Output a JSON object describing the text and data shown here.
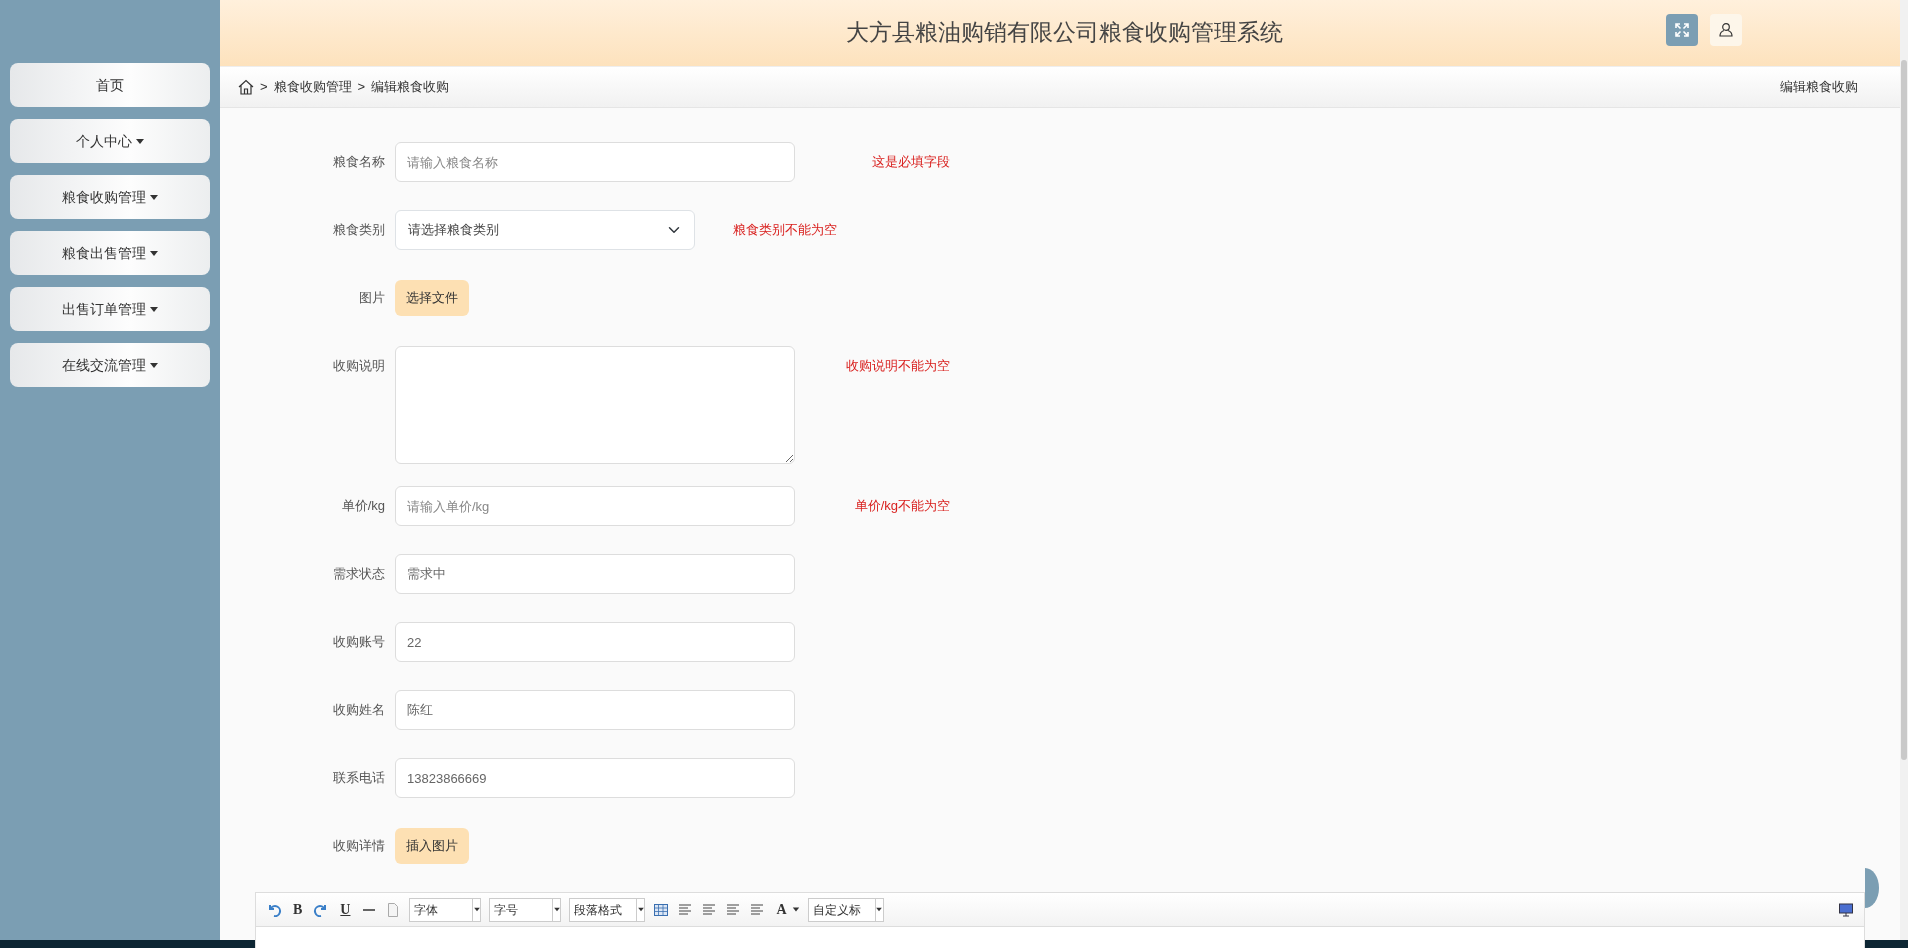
{
  "header": {
    "title": "大方县粮油购销有限公司粮食收购管理系统"
  },
  "sidebar": {
    "items": [
      {
        "label": "首页",
        "dropdown": false
      },
      {
        "label": "个人中心",
        "dropdown": true
      },
      {
        "label": "粮食收购管理",
        "dropdown": true
      },
      {
        "label": "粮食出售管理",
        "dropdown": true
      },
      {
        "label": "出售订单管理",
        "dropdown": true
      },
      {
        "label": "在线交流管理",
        "dropdown": true
      }
    ]
  },
  "breadcrumb": {
    "separator": ">",
    "items": [
      "粮食收购管理",
      "编辑粮食收购"
    ],
    "page_title": "编辑粮食收购"
  },
  "form": {
    "fields": [
      {
        "kind": "input",
        "label": "粮食名称",
        "placeholder": "请输入粮食名称",
        "error": "这是必填字段"
      },
      {
        "kind": "select",
        "label": "粮食类别",
        "value": "请选择粮食类别",
        "error": "粮食类别不能为空"
      },
      {
        "kind": "file",
        "label": "图片",
        "button": "选择文件"
      },
      {
        "kind": "textarea",
        "label": "收购说明",
        "error": "收购说明不能为空"
      },
      {
        "kind": "input",
        "label": "单价/kg",
        "placeholder": "请输入单价/kg",
        "error": "单价/kg不能为空"
      },
      {
        "kind": "input",
        "label": "需求状态",
        "value": "需求中"
      },
      {
        "kind": "input",
        "label": "收购账号",
        "value": "22"
      },
      {
        "kind": "input",
        "label": "收购姓名",
        "value": "陈红"
      },
      {
        "kind": "input",
        "label": "联系电话",
        "value": "13823866669"
      },
      {
        "kind": "file",
        "label": "收购详情",
        "button": "插入图片"
      }
    ]
  },
  "editor": {
    "toolbar": [
      {
        "kind": "undo"
      },
      {
        "kind": "text",
        "label": "B"
      },
      {
        "kind": "redo"
      },
      {
        "kind": "text",
        "label": "U"
      },
      {
        "kind": "hr"
      },
      {
        "kind": "doc"
      },
      {
        "kind": "select",
        "label": "字体"
      },
      {
        "kind": "select",
        "label": "字号"
      },
      {
        "kind": "select",
        "label": "段落格式"
      },
      {
        "kind": "table"
      },
      {
        "kind": "align"
      },
      {
        "kind": "align"
      },
      {
        "kind": "align"
      },
      {
        "kind": "align"
      },
      {
        "kind": "color",
        "label": "A"
      },
      {
        "kind": "select",
        "label": "自定义标"
      }
    ]
  }
}
